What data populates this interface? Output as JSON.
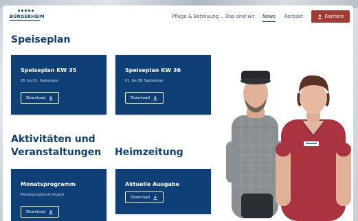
{
  "logo": {
    "text": "BÜRGERHEIM"
  },
  "nav": {
    "items": [
      {
        "label": "Pflege & Betreuung",
        "has_dropdown": true
      },
      {
        "label": "Das sind wir"
      },
      {
        "label": "News",
        "active": true
      },
      {
        "label": "Kontakt"
      }
    ],
    "cta": {
      "label": "Karriere",
      "icon": "user-icon"
    }
  },
  "sections": {
    "speiseplan": {
      "heading": "Speiseplan",
      "cards": [
        {
          "title": "Speiseplan KW 35",
          "subtitle": "26. bis 01. September",
          "button": "Download"
        },
        {
          "title": "Speiseplan KW 36",
          "subtitle": "01. bis 08. September",
          "button": "Download"
        }
      ]
    },
    "aktivitaeten": {
      "heading": "Aktivitäten und Veranstaltungen",
      "card": {
        "title": "Monatsprogramm",
        "subtitle": "Monatsprogramm August",
        "button": "Download"
      }
    },
    "heimzeitung": {
      "heading": "Heimzeitung",
      "card": {
        "title": "Aktuelle Ausgabe",
        "button": "Download"
      }
    }
  },
  "colors": {
    "brand": "#0e3f77",
    "accent": "#a33a34",
    "card_text": "#ffffff"
  }
}
